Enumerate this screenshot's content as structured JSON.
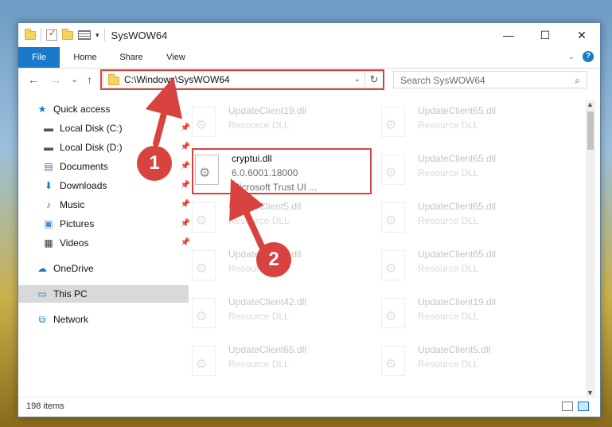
{
  "window": {
    "title": "SysWOW64",
    "controls": {
      "minimize": "—",
      "maximize": "☐",
      "close": "✕"
    }
  },
  "ribbon": {
    "tabs": [
      "File",
      "Home",
      "Share",
      "View"
    ],
    "help": "?"
  },
  "navigation": {
    "back": "←",
    "forward": "→",
    "recent": "⌄",
    "up": "↑",
    "address": "C:\\Windows\\SysWOW64",
    "search_placeholder": "Search SysWOW64"
  },
  "sidebar": {
    "items": [
      {
        "label": "Quick access",
        "icon": "star-icon",
        "pinned": false
      },
      {
        "label": "Local Disk (C:)",
        "icon": "disk-icon",
        "pinned": true
      },
      {
        "label": "Local Disk (D:)",
        "icon": "disk-icon",
        "pinned": true
      },
      {
        "label": "Documents",
        "icon": "documents-icon",
        "pinned": true
      },
      {
        "label": "Downloads",
        "icon": "download-icon",
        "pinned": true
      },
      {
        "label": "Music",
        "icon": "music-icon",
        "pinned": true
      },
      {
        "label": "Pictures",
        "icon": "pictures-icon",
        "pinned": true
      },
      {
        "label": "Videos",
        "icon": "videos-icon",
        "pinned": true
      },
      {
        "label": "OneDrive",
        "icon": "cloud-icon",
        "pinned": false
      },
      {
        "label": "This PC",
        "icon": "computer-icon",
        "pinned": false,
        "selected": true
      },
      {
        "label": "Network",
        "icon": "network-icon",
        "pinned": false
      }
    ]
  },
  "files": {
    "left_column": [
      {
        "name": "UpdateClient19.dll",
        "type": "Resource DLL"
      },
      {
        "name": "cryptui.dll",
        "type": "6.0.6001.18000",
        "description": "Microsoft Trust UI ..."
      },
      {
        "name": "UpdateClient5.dll",
        "type": "Resource DLL"
      },
      {
        "name": "UpdateClient5.dll",
        "type": "Resource DLL"
      },
      {
        "name": "UpdateClient42.dll",
        "type": "Resource DLL"
      },
      {
        "name": "UpdateClient65.dll",
        "type": "Resource DLL"
      }
    ],
    "right_column": [
      {
        "name": "UpdateClient65.dll",
        "type": "Resource DLL"
      },
      {
        "name": "UpdateClient65.dll",
        "type": "Resource DLL"
      },
      {
        "name": "UpdateClient65.dll",
        "type": "Resource DLL"
      },
      {
        "name": "UpdateClient65.dll",
        "type": "Resource DLL"
      },
      {
        "name": "UpdateClient19.dll",
        "type": "Resource DLL"
      },
      {
        "name": "UpdateClient5.dll",
        "type": "Resource DLL"
      }
    ]
  },
  "status": {
    "item_count": "198 items"
  },
  "annotations": {
    "badge1": "1",
    "badge2": "2",
    "accent": "#d8433f"
  }
}
